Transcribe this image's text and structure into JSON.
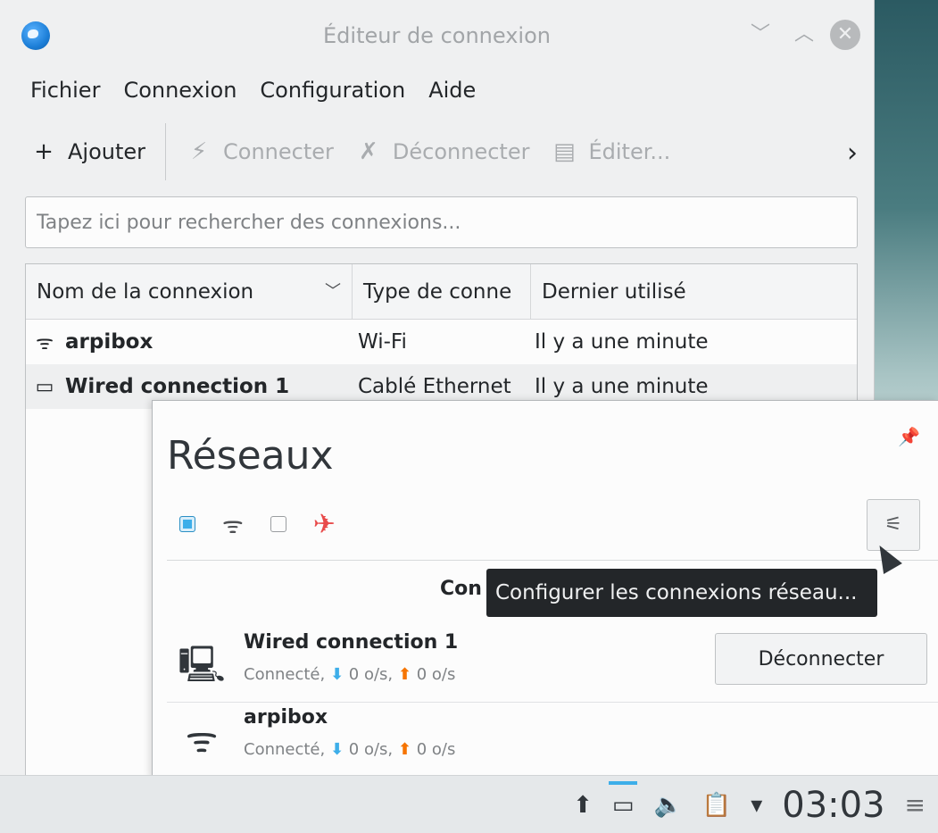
{
  "window": {
    "title": "Éditeur de connexion",
    "controls": {
      "minimize": "﹀",
      "maximize": "︿",
      "close": "✕"
    }
  },
  "menubar": [
    "Fichier",
    "Connexion",
    "Configuration",
    "Aide"
  ],
  "toolbar": {
    "add_label": "Ajouter",
    "connect_label": "Connecter",
    "disconnect_label": "Déconnecter",
    "edit_label": "Éditer...",
    "more": "›"
  },
  "search": {
    "placeholder": "Tapez ici pour rechercher des connexions..."
  },
  "table": {
    "columns": [
      "Nom de la connexion",
      "Type de conne",
      "Dernier utilisé"
    ],
    "rows": [
      {
        "icon": "wifi-icon",
        "name": "arpibox",
        "type": "Wi-Fi",
        "last_used": "Il y a une minute"
      },
      {
        "icon": "ethernet-icon",
        "name": "Wired connection 1",
        "type": "Cablé Ethernet",
        "last_used": "Il y a une minute"
      }
    ]
  },
  "networks_popup": {
    "title": "Réseaux",
    "section_header": "Con",
    "tooltip": "Configurer les connexions réseau...",
    "items": [
      {
        "name": "Wired connection 1",
        "status": "Connecté,",
        "down": "0 o/s,",
        "up": "0 o/s",
        "action": "Déconnecter"
      },
      {
        "name": "arpibox",
        "status": "Connecté,",
        "down": "0 o/s,",
        "up": "0 o/s"
      }
    ]
  },
  "taskbar": {
    "clock": "03:03"
  },
  "colors": {
    "accent": "#3daee9",
    "upload": "#f67400",
    "airplane": "#e84a4a"
  }
}
